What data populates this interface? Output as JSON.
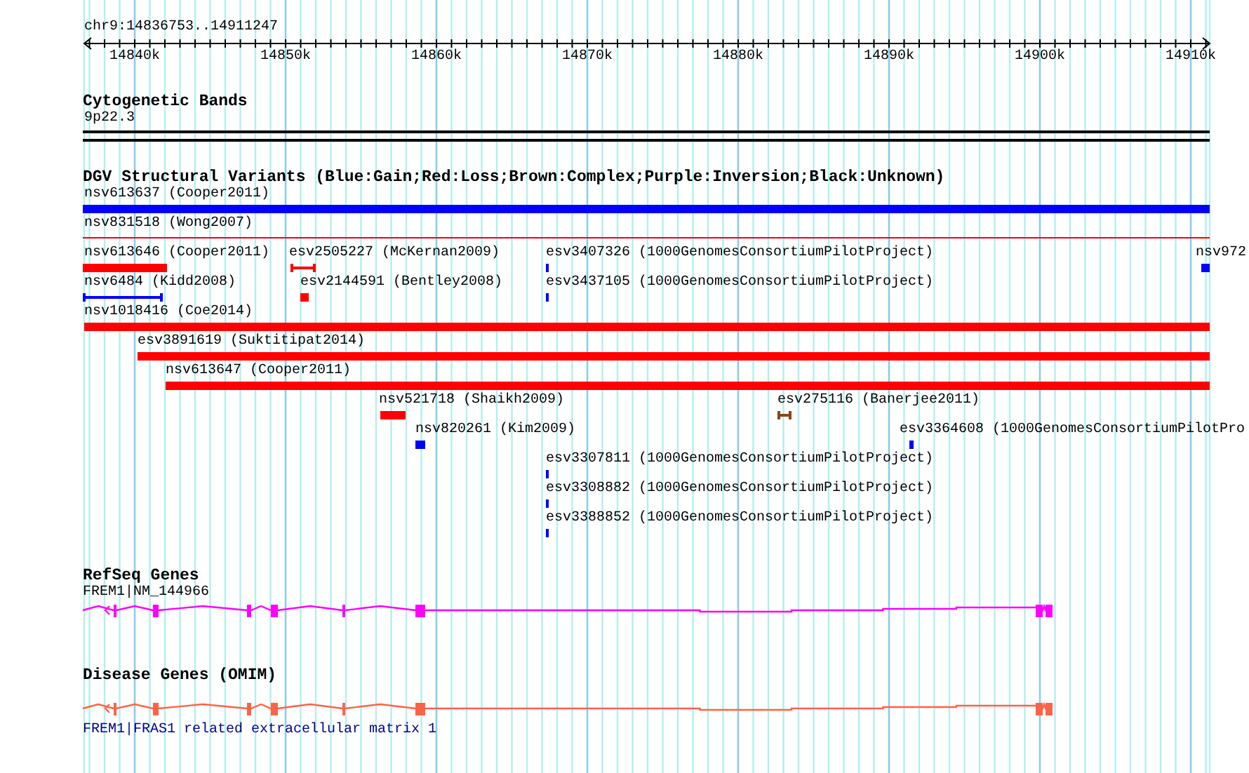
{
  "ruler": {
    "location": "chr9:14836753..14911247",
    "ticks": [
      "14840k",
      "14850k",
      "14860k",
      "14870k",
      "14880k",
      "14890k",
      "14900k",
      "14910k"
    ]
  },
  "tracks": [
    {
      "kind": "cytoband",
      "title": "Cytogenetic Bands",
      "band": "9p22.3"
    },
    {
      "kind": "variants",
      "title": "DGV Structural Variants (Blue:Gain;Red:Loss;Brown:Complex;Purple:Inversion;Black:Unknown)",
      "rows": [
        [
          {
            "label": "nsv613637 (Cooper2011)",
            "kind": "bar",
            "color": "#0000ff"
          }
        ],
        [
          {
            "label": "nsv831518 (Wong2007)",
            "kind": "line",
            "color": "#ff0000"
          }
        ],
        [
          {
            "label": "nsv613646 (Cooper2011)",
            "kind": "bar",
            "color": "#ff0000"
          },
          {
            "label": "esv2505227 (McKernan2009)",
            "kind": "interval",
            "color": "#ff0000"
          },
          {
            "label": "esv3407326 (1000GenomesConsortiumPilotProject)",
            "kind": "bar",
            "color": "#0000ff"
          },
          {
            "label": "nsv972",
            "kind": "bar",
            "color": "#0000ff"
          }
        ],
        [
          {
            "label": "nsv6484 (Kidd2008)",
            "kind": "interval",
            "color": "#0000ff"
          },
          {
            "label": "esv2144591 (Bentley2008)",
            "kind": "bar",
            "color": "#ff0000"
          },
          {
            "label": "esv3437105 (1000GenomesConsortiumPilotProject)",
            "kind": "bar",
            "color": "#0000ff"
          }
        ],
        [
          {
            "label": "nsv1018416 (Coe2014)",
            "kind": "bar",
            "color": "#ff0000"
          }
        ],
        [
          {
            "label": "esv3891619 (Suktitipat2014)",
            "kind": "bar",
            "color": "#ff0000"
          }
        ],
        [
          {
            "label": "nsv613647 (Cooper2011)",
            "kind": "bar",
            "color": "#ff0000"
          }
        ],
        [
          {
            "label": "nsv521718 (Shaikh2009)",
            "kind": "bar",
            "color": "#ff0000"
          },
          {
            "label": "esv275116 (Banerjee2011)",
            "kind": "interval",
            "color": "#8b4513"
          }
        ],
        [
          {
            "label": "nsv820261 (Kim2009)",
            "kind": "bar",
            "color": "#0000ff"
          },
          {
            "label": "esv3364608 (1000GenomesConsortiumPilotPro",
            "kind": "bar",
            "color": "#0000ff"
          }
        ],
        [
          {
            "label": "esv3307811 (1000GenomesConsortiumPilotProject)",
            "kind": "bar",
            "color": "#0000ff"
          }
        ],
        [
          {
            "label": "esv3308882 (1000GenomesConsortiumPilotProject)",
            "kind": "bar",
            "color": "#0000ff"
          }
        ],
        [
          {
            "label": "esv3388852 (1000GenomesConsortiumPilotProject)",
            "kind": "bar",
            "color": "#0000ff"
          }
        ]
      ]
    },
    {
      "kind": "gene",
      "title": "RefSeq Genes",
      "name": "FREM1|NM_144966",
      "color": "#ff00ff",
      "label_below": false
    },
    {
      "kind": "gene",
      "title": "Disease Genes (OMIM)",
      "name": "FREM1|FRAS1 related extracellular matrix 1",
      "color": "#ff6347",
      "label_below": true
    }
  ]
}
